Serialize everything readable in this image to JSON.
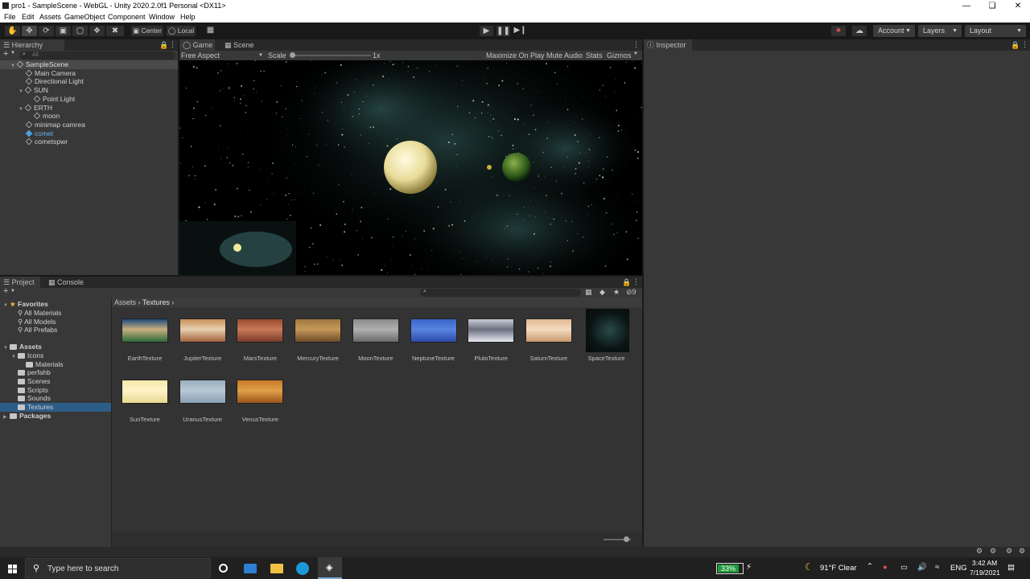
{
  "window": {
    "title": "pro1 - SampleScene - WebGL - Unity 2020.2.0f1 Personal <DX11>"
  },
  "menu": [
    "File",
    "Edit",
    "Assets",
    "GameObject",
    "Component",
    "Window",
    "Help"
  ],
  "toolbar": {
    "center_label": "Center",
    "local_label": "Local",
    "account_label": "Account",
    "layers_label": "Layers",
    "layout_label": "Layout"
  },
  "hierarchy": {
    "tab": "Hierarchy",
    "search_placeholder": "All",
    "items": [
      {
        "label": "SampleScene",
        "indent": 0,
        "kind": "scene",
        "expanded": true
      },
      {
        "label": "Main Camera",
        "indent": 1,
        "kind": "obj"
      },
      {
        "label": "Directional Light",
        "indent": 1,
        "kind": "obj"
      },
      {
        "label": "SUN",
        "indent": 1,
        "kind": "obj",
        "expanded": true
      },
      {
        "label": "Point Light",
        "indent": 2,
        "kind": "obj"
      },
      {
        "label": "ERTH",
        "indent": 1,
        "kind": "obj",
        "expanded": true
      },
      {
        "label": "moon",
        "indent": 2,
        "kind": "obj"
      },
      {
        "label": "minimap camrea",
        "indent": 1,
        "kind": "obj"
      },
      {
        "label": "comet",
        "indent": 1,
        "kind": "prefab"
      },
      {
        "label": "cometspwr",
        "indent": 1,
        "kind": "obj"
      }
    ]
  },
  "game": {
    "tabs": [
      "Game",
      "Scene"
    ],
    "aspect": "Free Aspect",
    "scale_label": "Scale",
    "scale_value": "1x",
    "toggles": [
      "Maximize On Play",
      "Mute Audio",
      "Stats",
      "Gizmos"
    ]
  },
  "inspector": {
    "tab": "Inspector"
  },
  "project": {
    "tabs": [
      "Project",
      "Console"
    ],
    "hidden_count": "9",
    "breadcrumb": [
      "Assets",
      "Textures"
    ],
    "favorites": {
      "title": "Favorites",
      "items": [
        "All Materials",
        "All Models",
        "All Prefabs"
      ]
    },
    "tree": [
      {
        "label": "Assets",
        "indent": 0,
        "bold": true,
        "expanded": true
      },
      {
        "label": "Icons",
        "indent": 1,
        "expanded": true
      },
      {
        "label": "Materials",
        "indent": 2
      },
      {
        "label": "perfahb",
        "indent": 1
      },
      {
        "label": "Scenes",
        "indent": 1
      },
      {
        "label": "Scripts",
        "indent": 1
      },
      {
        "label": "Sounds",
        "indent": 1
      },
      {
        "label": "Textures",
        "indent": 1,
        "selected": true
      },
      {
        "label": "Packages",
        "indent": 0,
        "bold": true
      }
    ],
    "assets": [
      {
        "name": "EarthTexture",
        "colors": [
          "#1e4a7a",
          "#c8b080",
          "#2e6a3a"
        ]
      },
      {
        "name": "JupiterTexture",
        "colors": [
          "#c8905a",
          "#e8d0b0",
          "#a0603a"
        ]
      },
      {
        "name": "MarsTexture",
        "colors": [
          "#9a4a30",
          "#c87a58",
          "#7a3a2a"
        ]
      },
      {
        "name": "MercuryTexture",
        "colors": [
          "#a07840",
          "#c89858",
          "#6a4a28"
        ]
      },
      {
        "name": "MoonTexture",
        "colors": [
          "#8a8a8a",
          "#b0b0b0",
          "#6a6a6a"
        ]
      },
      {
        "name": "NeptuneTexture",
        "colors": [
          "#3a64c8",
          "#5a84e0",
          "#2a4aa8"
        ]
      },
      {
        "name": "PlutoTexture",
        "colors": [
          "#c8ccd4",
          "#6a7080",
          "#e8e8f0"
        ]
      },
      {
        "name": "SaturnTexture",
        "colors": [
          "#e0b890",
          "#f4dcc0",
          "#c89870"
        ]
      },
      {
        "name": "SpaceTexture",
        "colors": [
          "#0a1414",
          "#2a4a48",
          "#0a0a0a"
        ]
      },
      {
        "name": "SunTexture",
        "colors": [
          "#f4e8a8",
          "#fff4c8",
          "#e8d890"
        ]
      },
      {
        "name": "UranusTexture",
        "colors": [
          "#9ab0c0",
          "#b8c8d4",
          "#8aa0b4"
        ]
      },
      {
        "name": "VenusTexture",
        "colors": [
          "#c87a28",
          "#e0a048",
          "#9a5418"
        ]
      }
    ]
  },
  "taskbar": {
    "search_placeholder": "Type here to search",
    "battery": "33%",
    "weather": "91°F  Clear",
    "lang": "ENG",
    "time": "3:42 AM",
    "date": "7/19/2021"
  }
}
